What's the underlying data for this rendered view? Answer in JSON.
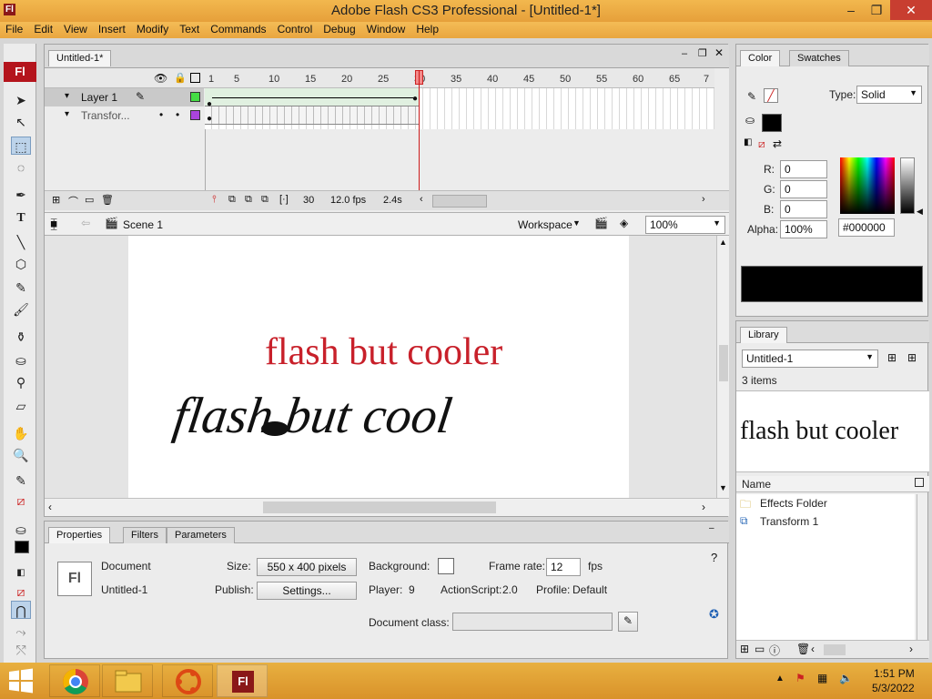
{
  "window": {
    "title": "Adobe Flash CS3 Professional - [Untitled-1*]",
    "app_badge": "Fl",
    "minimize": "–",
    "restore": "❐",
    "close": "✕"
  },
  "menu": [
    "File",
    "Edit",
    "View",
    "Insert",
    "Modify",
    "Text",
    "Commands",
    "Control",
    "Debug",
    "Window",
    "Help"
  ],
  "toolbox": {
    "logo": "Fl"
  },
  "document": {
    "tab": "Untitled-1*",
    "timeline": {
      "ruler": [
        "1",
        "5",
        "10",
        "15",
        "20",
        "25",
        "30",
        "35",
        "40",
        "45",
        "50",
        "55",
        "60",
        "65",
        "7"
      ],
      "layers": [
        {
          "name": "Layer 1",
          "color": "#44dd44"
        },
        {
          "name": "Transfor...",
          "color": "#aa44dd"
        }
      ],
      "status": {
        "frame": "30",
        "fps": "12.0 fps",
        "time": "2.4s"
      }
    },
    "editbar": {
      "scene": "Scene 1",
      "workspace": "Workspace",
      "zoom": "100%"
    },
    "stage": {
      "text_red": "flash but cooler",
      "text_italic": "flash but cool",
      "red_color": "#c8202a"
    }
  },
  "properties": {
    "tabs": [
      "Properties",
      "Filters",
      "Parameters"
    ],
    "type_icon": "Fl",
    "type_label": "Document",
    "doc_name": "Untitled-1",
    "size_label": "Size:",
    "size_value": "550 x 400 pixels",
    "background_label": "Background:",
    "framerate_label": "Frame rate:",
    "framerate_value": "12",
    "fps_unit": "fps",
    "publish_label": "Publish:",
    "settings_button": "Settings...",
    "player_label": "Player:",
    "player_value": "9",
    "actionscript_label": "ActionScript:",
    "actionscript_value": "2.0",
    "profile_label": "Profile:",
    "profile_value": "Default",
    "docclass_label": "Document class:",
    "docclass_value": ""
  },
  "color_panel": {
    "tabs": [
      "Color",
      "Swatches"
    ],
    "type_label": "Type:",
    "type_value": "Solid",
    "r_label": "R:",
    "r_value": "0",
    "g_label": "G:",
    "g_value": "0",
    "b_label": "B:",
    "b_value": "0",
    "alpha_label": "Alpha:",
    "alpha_value": "100%",
    "hex_value": "#000000",
    "swatch_color": "#000000"
  },
  "library_panel": {
    "tab": "Library",
    "doc_select": "Untitled-1",
    "count": "3 items",
    "preview_text": "flash but cooler",
    "name_header": "Name",
    "items": [
      {
        "name": "Effects Folder",
        "icon": "folder-icon"
      },
      {
        "name": "Transform 1",
        "icon": "graphic-symbol-icon"
      }
    ]
  },
  "taskbar": {
    "time": "1:51 PM",
    "date": "5/3/2022",
    "flash_badge": "Fl"
  }
}
